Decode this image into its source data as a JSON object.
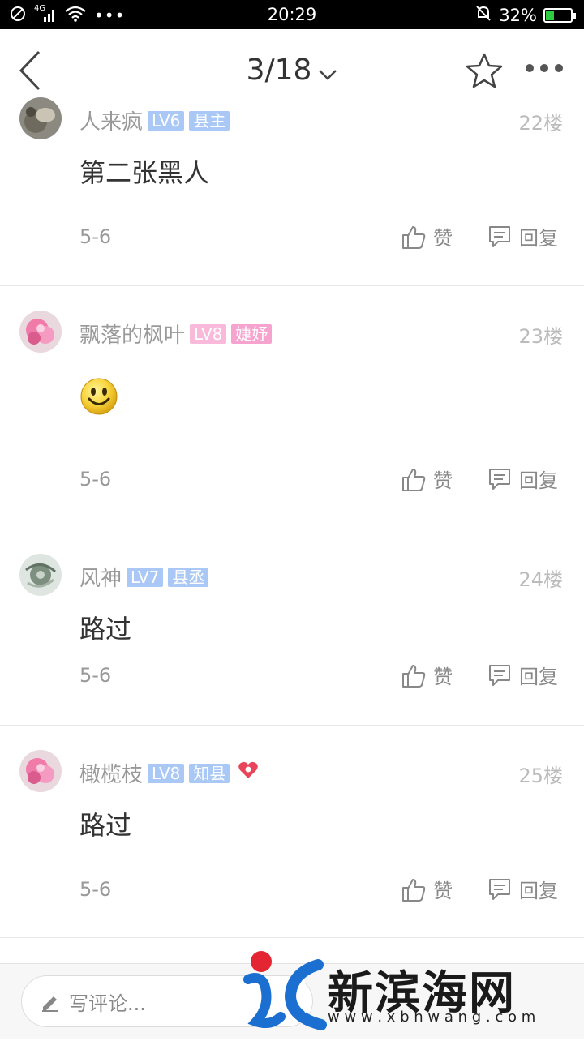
{
  "status_bar": {
    "network": "4G",
    "time": "20:29",
    "battery_pct": "32%",
    "battery_level": 0.32
  },
  "nav": {
    "page_indicator": "3/18"
  },
  "floors": [
    {
      "user": "人来疯",
      "level": "LV6",
      "title": "县主",
      "floor": "22楼",
      "content": "第二张黑人",
      "date": "5-6",
      "like_label": "赞",
      "reply_label": "回复"
    },
    {
      "user": "飘落的枫叶",
      "level": "LV8",
      "title": "婕妤",
      "floor": "23楼",
      "content": "",
      "content_emoji": "smiley-face-emoticon",
      "date": "5-6",
      "like_label": "赞",
      "reply_label": "回复"
    },
    {
      "user": "风神",
      "level": "LV7",
      "title": "县丞",
      "floor": "24楼",
      "content": "路过",
      "date": "5-6",
      "like_label": "赞",
      "reply_label": "回复"
    },
    {
      "user": "橄榄枝",
      "level": "LV8",
      "title": "知县",
      "floor": "25楼",
      "content": "路过",
      "date": "5-6",
      "like_label": "赞",
      "reply_label": "回复",
      "extra_badge": "heart-icon"
    }
  ],
  "bottom_bar": {
    "comment_placeholder": "写评论..."
  },
  "watermark": {
    "name": "新滨海网",
    "url": "w w w . x b h w a n g . c o m"
  },
  "colors": {
    "badge_blue": "#a9c8f5",
    "badge_pink": "#f7a3cf",
    "heart": "#e8455b",
    "watermark_blue": "#1a6fd1",
    "watermark_red": "#e32631"
  }
}
